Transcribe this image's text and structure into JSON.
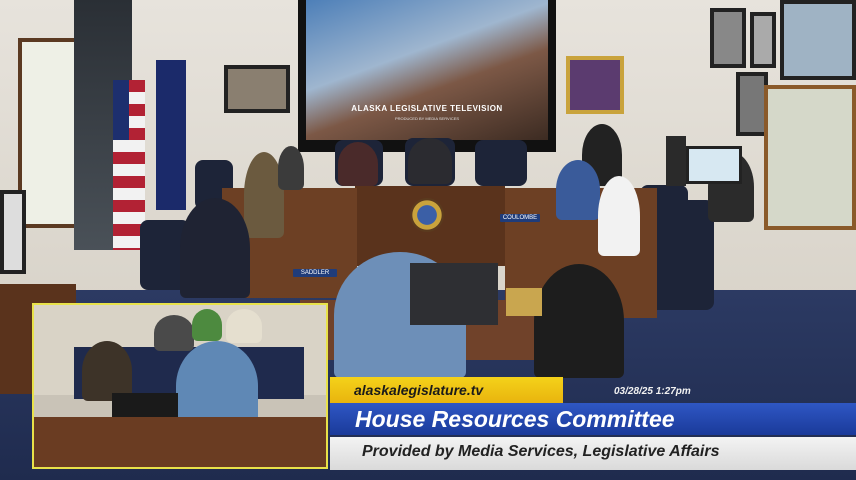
{
  "scene": {
    "screen_caption": "ALASKA LEGISLATIVE TELEVISION",
    "screen_subcaption": "PRODUCED BY MEDIA SERVICES",
    "nameplates": [
      "SADDLER",
      "",
      "",
      "",
      "",
      "COULOMBE",
      ""
    ]
  },
  "overlay": {
    "url": "alaskalegislature.tv",
    "datetime": "03/28/25 1:27pm",
    "committee": "House Resources Committee",
    "provider": "Provided by Media Services, Legislative Affairs"
  },
  "colors": {
    "accent_yellow": "#f4d21a",
    "banner_blue": "#2f57c4",
    "banner_white": "#f3f3f3",
    "pip_border": "#e8e24a"
  }
}
